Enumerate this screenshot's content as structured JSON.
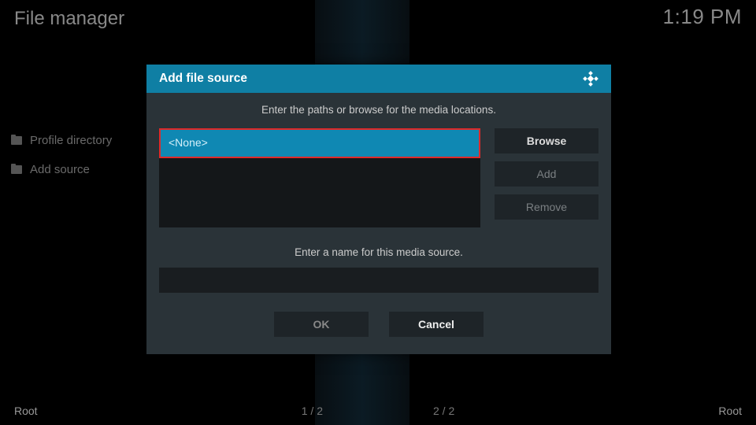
{
  "header": {
    "title": "File manager",
    "clock": "1:19 PM"
  },
  "sidebar": {
    "items": [
      {
        "label": "Profile directory"
      },
      {
        "label": "Add source"
      }
    ]
  },
  "footer": {
    "left": "Root",
    "center1": "1 / 2",
    "center2": "2 / 2",
    "right": "Root"
  },
  "dialog": {
    "title": "Add file source",
    "instruction1": "Enter the paths or browse for the media locations.",
    "path_value": "<None>",
    "buttons": {
      "browse": "Browse",
      "add": "Add",
      "remove": "Remove"
    },
    "instruction2": "Enter a name for this media source.",
    "name_value": "",
    "ok": "OK",
    "cancel": "Cancel"
  }
}
